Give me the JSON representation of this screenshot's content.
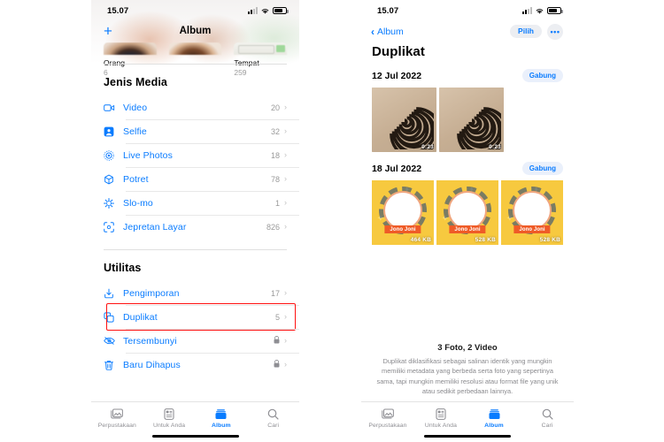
{
  "left_phone": {
    "status_bar": {
      "time": "15.07",
      "signal_icon": "cellular-signal-icon",
      "wifi_icon": "wifi-icon",
      "battery_icon": "battery-icon"
    },
    "nav": {
      "add_label": "+",
      "title": "Album"
    },
    "album_cards": [
      {
        "name": "Orang",
        "count": "6"
      },
      {
        "name": "Tempat",
        "count": "259"
      }
    ],
    "sections": [
      {
        "heading": "Jenis Media",
        "rows": [
          {
            "icon": "video-icon",
            "label": "Video",
            "count": "20",
            "locked": false
          },
          {
            "icon": "selfie-icon",
            "label": "Selfie",
            "count": "32",
            "locked": false
          },
          {
            "icon": "live-photo-icon",
            "label": "Live Photos",
            "count": "18",
            "locked": false
          },
          {
            "icon": "portrait-icon",
            "label": "Potret",
            "count": "78",
            "locked": false
          },
          {
            "icon": "slomo-icon",
            "label": "Slo-mo",
            "count": "1",
            "locked": false
          },
          {
            "icon": "screenshot-icon",
            "label": "Jepretan Layar",
            "count": "826",
            "locked": false
          }
        ]
      },
      {
        "heading": "Utilitas",
        "rows": [
          {
            "icon": "import-icon",
            "label": "Pengimporan",
            "count": "17",
            "locked": false
          },
          {
            "icon": "duplicate-icon",
            "label": "Duplikat",
            "count": "5",
            "locked": false,
            "highlighted": true
          },
          {
            "icon": "hidden-eye-icon",
            "label": "Tersembunyi",
            "count": "",
            "locked": true
          },
          {
            "icon": "trash-icon",
            "label": "Baru Dihapus",
            "count": "",
            "locked": true
          }
        ]
      }
    ],
    "tabs": [
      {
        "icon": "library-icon",
        "label": "Perpustakaan",
        "active": false
      },
      {
        "icon": "foryou-icon",
        "label": "Untuk Anda",
        "active": false
      },
      {
        "icon": "albums-icon",
        "label": "Album",
        "active": true
      },
      {
        "icon": "search-icon",
        "label": "Cari",
        "active": false
      }
    ]
  },
  "right_phone": {
    "status_bar": {
      "time": "15.07",
      "signal_icon": "cellular-signal-icon",
      "wifi_icon": "wifi-icon",
      "battery_icon": "battery-icon"
    },
    "nav": {
      "back_label": "Album",
      "select_label": "Pilih",
      "more_label": "•••"
    },
    "title": "Duplikat",
    "groups": [
      {
        "date": "12 Jul 2022",
        "merge_label": "Gabung",
        "items": [
          {
            "kind": "coil",
            "badge": "0:23"
          },
          {
            "kind": "coil",
            "badge": "0:23"
          }
        ]
      },
      {
        "date": "18 Jul 2022",
        "merge_label": "Gabung",
        "items": [
          {
            "kind": "poster",
            "name": "Jono Joni",
            "badge": "464 KB"
          },
          {
            "kind": "poster",
            "name": "Jono Joni",
            "badge": "528 KB"
          },
          {
            "kind": "poster",
            "name": "Jono Joni",
            "badge": "528 KB"
          }
        ]
      }
    ],
    "footer": {
      "count": "3 Foto, 2 Video",
      "description": "Duplikat diklasifikasi sebagai salinan identik yang mungkin memiliki metadata yang berbeda serta foto yang sepertinya sama, tapi mungkin memiliki resolusi atau format file yang unik atau sedikit perbedaan lainnya."
    },
    "tabs": [
      {
        "icon": "library-icon",
        "label": "Perpustakaan",
        "active": false
      },
      {
        "icon": "foryou-icon",
        "label": "Untuk Anda",
        "active": false
      },
      {
        "icon": "albums-icon",
        "label": "Album",
        "active": true
      },
      {
        "icon": "search-icon",
        "label": "Cari",
        "active": false
      }
    ]
  },
  "colors": {
    "accent_blue": "#0a7cff",
    "highlight_red": "#ff1111",
    "muted_gray": "#9a9a9a",
    "pill_bg": "#eceef2"
  }
}
